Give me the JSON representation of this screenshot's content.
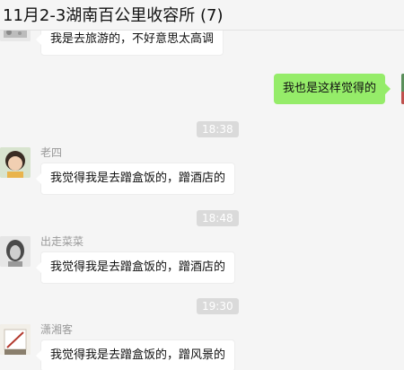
{
  "window": {
    "title": "11月2-3湖南百公里收容所 (7)"
  },
  "messages": [
    {
      "type": "in",
      "sender": "",
      "text": "我是去旅游的，不好意思太高调"
    },
    {
      "type": "out",
      "text": "我也是这样觉得的"
    },
    {
      "type": "time",
      "text": "18:38"
    },
    {
      "type": "in",
      "sender": "老四",
      "text": "我觉得我是去蹭盒饭的，蹭酒店的"
    },
    {
      "type": "time",
      "text": "18:48"
    },
    {
      "type": "in",
      "sender": "出走菜菜",
      "text": "我觉得我是去蹭盒饭的，蹭酒店的"
    },
    {
      "type": "time",
      "text": "19:30"
    },
    {
      "type": "in",
      "sender": "潇湘客",
      "text": "我觉得我是去蹭盒饭的，蹭风景的"
    }
  ],
  "colors": {
    "outgoing_bubble": "#95ec69",
    "incoming_bubble": "#ffffff",
    "time_badge": "#dadada"
  }
}
